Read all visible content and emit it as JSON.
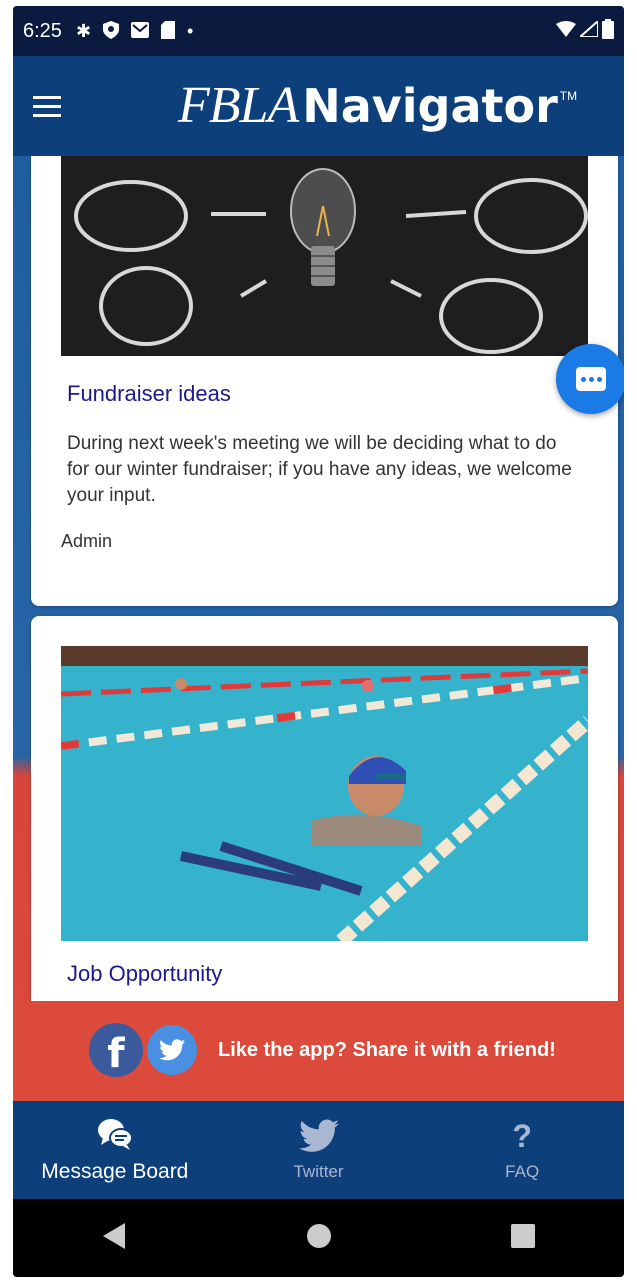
{
  "status_bar": {
    "time": "6:25"
  },
  "app_bar": {
    "logo_primary": "FBLA",
    "logo_secondary": "Navigator",
    "logo_tm": "TM"
  },
  "posts": [
    {
      "title": "Fundraiser ideas",
      "body": "During next week's meeting we will be deciding what to do for our winter fundraiser; if you have any ideas, we welcome your input.",
      "author": "Admin"
    },
    {
      "title": "Job Opportunity"
    }
  ],
  "share_banner": {
    "text": "Like the app? Share it with a friend!"
  },
  "bottom_nav": {
    "items": [
      {
        "label": "Message Board",
        "icon": "chat-bubbles-icon"
      },
      {
        "label": "Twitter",
        "icon": "twitter-icon"
      },
      {
        "label": "FAQ",
        "icon": "question-icon"
      }
    ]
  },
  "colors": {
    "primary": "#0d3f7a",
    "accent_red": "#dc4a3c",
    "fab_blue": "#1a7ae6",
    "title_text": "#1a1a8a"
  }
}
